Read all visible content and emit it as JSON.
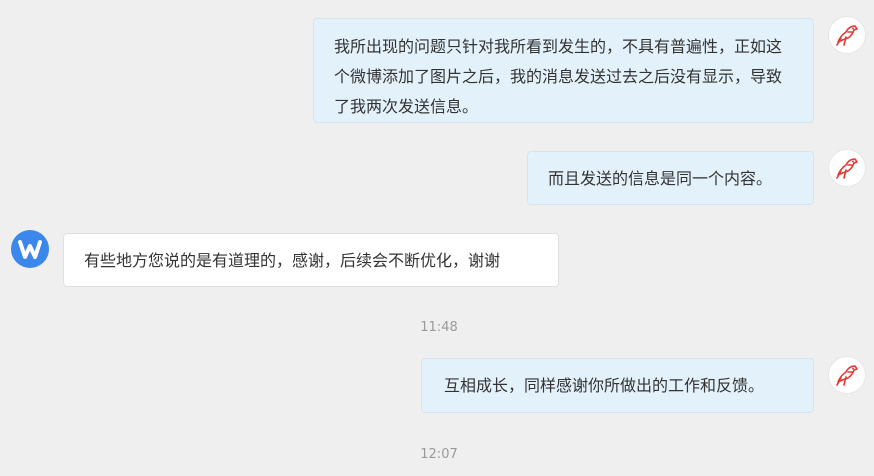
{
  "messages": [
    {
      "from": "me",
      "text": "我所出现的问题只针对我所看到发生的，不具有普遍性，正如这个微博添加了图片之后，我的消息发送过去之后没有显示，导致了我两次发送信息。"
    },
    {
      "from": "me",
      "text": "而且发送的信息是同一个内容。"
    },
    {
      "from": "other",
      "text": "有些地方您说的是有道理的，感谢，后续会不断优化，谢谢"
    },
    {
      "from": "me",
      "text": "互相成长，同样感谢你所做出的工作和反馈。"
    }
  ],
  "timestamps": [
    "11:48",
    "12:07"
  ],
  "icons": {
    "me_avatar": "red-bird-avatar-icon",
    "other_avatar": "blue-w-logo-icon"
  },
  "colors": {
    "background": "#efefef",
    "outgoing_bubble": "#e3f1fb",
    "incoming_bubble": "#ffffff",
    "bot_avatar": "#3c87ec",
    "bird_red": "#e53935",
    "timestamp": "#9a9a9a"
  }
}
